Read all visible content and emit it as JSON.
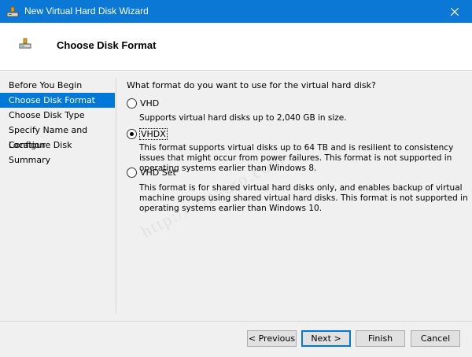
{
  "window": {
    "title": "New Virtual Hard Disk Wizard",
    "accent": "#0b78d6"
  },
  "header": {
    "title": "Choose Disk Format"
  },
  "nav": {
    "items": [
      {
        "label": "Before You Begin",
        "selected": false
      },
      {
        "label": "Choose Disk Format",
        "selected": true
      },
      {
        "label": "Choose Disk Type",
        "selected": false
      },
      {
        "label": "Specify Name and Location",
        "selected": false
      },
      {
        "label": "Configure Disk",
        "selected": false
      },
      {
        "label": "Summary",
        "selected": false
      }
    ]
  },
  "main": {
    "question": "What format do you want to use for the virtual hard disk?",
    "options": [
      {
        "label": "VHD",
        "selected": false,
        "description": "Supports virtual hard disks up to 2,040 GB in size."
      },
      {
        "label": "VHDX",
        "selected": true,
        "description": "This format supports virtual disks up to 64 TB and is resilient to consistency issues that might occur from power failures. This format is not supported in operating systems earlier than Windows 8."
      },
      {
        "label": "VHD Set",
        "selected": false,
        "description": "This format is for shared virtual hard disks only, and enables backup of virtual machine groups using shared virtual hard disks. This format is not supported in operating systems earlier than Windows 10."
      }
    ]
  },
  "watermark": "http://winaero.com",
  "footer": {
    "previous": "< Previous",
    "next": "Next >",
    "finish": "Finish",
    "cancel": "Cancel"
  },
  "icons": {
    "app": "disk-icon",
    "close": "close-icon"
  }
}
